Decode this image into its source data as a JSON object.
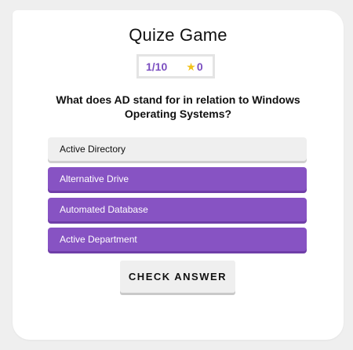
{
  "title": "Quize Game",
  "stats": {
    "question_progress": "1/10",
    "score": "0",
    "score_icon": "star-icon"
  },
  "question": "What does AD stand for in relation to Windows Operating Systems?",
  "options": [
    {
      "label": "Active Directory",
      "state": "selected"
    },
    {
      "label": "Alternative Drive",
      "state": "normal"
    },
    {
      "label": "Automated Database",
      "state": "normal"
    },
    {
      "label": "Active Department",
      "state": "normal"
    }
  ],
  "check_button_label": "CHECK ANSWER",
  "colors": {
    "accent": "#8753c3",
    "accent_shadow": "#6f3ea8",
    "selected_bg": "#efefef",
    "stat_text": "#7b4fc0",
    "star": "#f2c21b"
  }
}
